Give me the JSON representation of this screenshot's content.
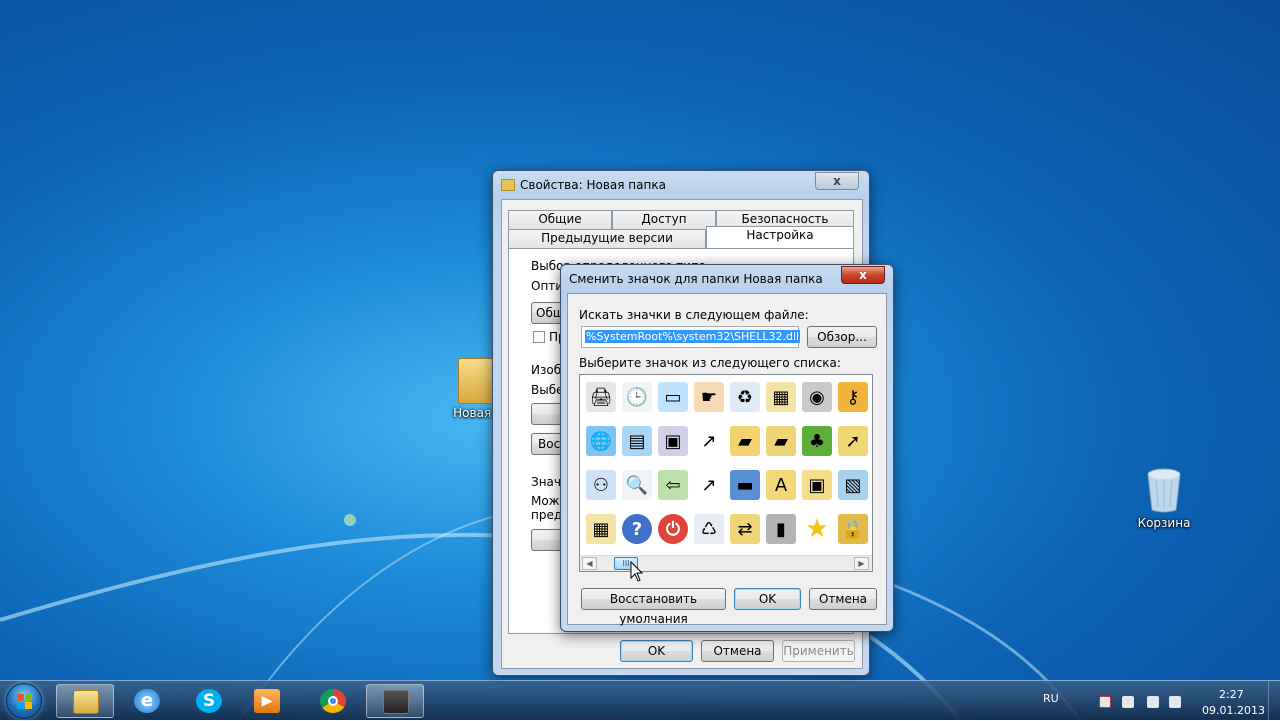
{
  "desktop": {
    "icons": [
      {
        "label": "Новая п",
        "icon": "folder-icon"
      },
      {
        "label": "Корзина",
        "icon": "recycle-bin-icon"
      }
    ]
  },
  "properties_window": {
    "title": "Свойства: Новая папка",
    "close_symbol": "x",
    "tabs_row1": [
      "Общие",
      "Доступ",
      "Безопасность"
    ],
    "tabs_row2": [
      "Предыдущие версии",
      "Настройка"
    ],
    "active_tab": "Настройка",
    "fragments": [
      "Выбор определенного типа папки",
      "Оптим",
      "Общ",
      "Пр",
      "Изобр",
      "Выбер",
      "Вос",
      "Значк",
      "Можн",
      "предс"
    ],
    "buttons": {
      "ok": "OK",
      "cancel": "Отмена",
      "apply": "Применить"
    }
  },
  "change_icon_dialog": {
    "title": "Сменить значок для папки Новая папка",
    "close_symbol": "x",
    "search_label": "Искать значки в следующем файле:",
    "file_path": "%SystemRoot%\\system32\\SHELL32.dll",
    "browse_button": "Обзор...",
    "list_label": "Выберите значок из следующего списка:",
    "icons": [
      [
        "printer-icon",
        "clock-document-icon",
        "window-icon",
        "hand-pointer-icon",
        "recycle-bin-icon",
        "grid-folder-icon",
        "cd-drive-icon",
        "key-icon"
      ],
      [
        "globe-network-icon",
        "control-panel-icon",
        "display-properties-icon",
        "shortcut-arrow-icon",
        "folder-open-icon",
        "folder-disk-icon",
        "tree-icon",
        "folder-arrow-icon"
      ],
      [
        "network-icon",
        "search-icon",
        "back-arrow-icon",
        "shortcut-overlay-icon",
        "monitor-icon",
        "fonts-folder-icon",
        "computer-folder-icon",
        "picture-icon"
      ],
      [
        "grid-folder-icon",
        "help-icon",
        "power-icon",
        "recycle-bin-empty-icon",
        "network-folder-icon",
        "server-icon",
        "star-icon",
        "lock-icon"
      ]
    ],
    "scroll_thumb": "III",
    "buttons": {
      "restore": "Восстановить умолчания",
      "ok": "OK",
      "cancel": "Отмена"
    }
  },
  "taskbar": {
    "apps": [
      "explorer-icon",
      "internet-explorer-icon",
      "skype-icon",
      "media-player-icon",
      "chrome-icon",
      "hypercam-icon"
    ],
    "language": "RU",
    "time": "2:27",
    "date": "09.01.2013"
  },
  "colors": {
    "accent": "#3399ff",
    "taskbar": "#1c3a5e",
    "desktop": "#1b8ad8"
  }
}
